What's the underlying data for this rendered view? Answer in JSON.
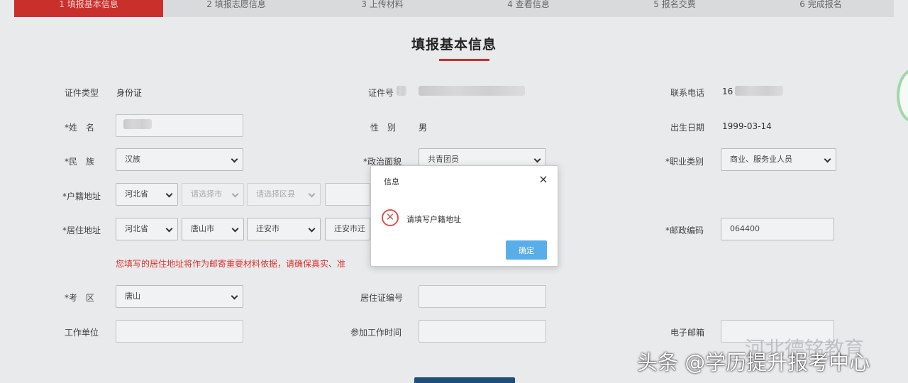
{
  "steps": [
    "1 填报基本信息",
    "2 填报志愿信息",
    "3 上传材料",
    "4 查看信息",
    "5 报名交费",
    "6 完成报名"
  ],
  "page_title": "填报基本信息",
  "form": {
    "id_type_label": "证件类型",
    "id_type_value": "身份证",
    "id_number_label": "证件号",
    "phone_label": "联系电话",
    "phone_value": "16",
    "name_label": "*姓　名",
    "gender_label": "性　别",
    "gender_value": "男",
    "birth_label": "出生日期",
    "birth_value": "1999-03-14",
    "ethnicity_label": "*民　族",
    "ethnicity_value": "汉族",
    "political_label": "*政治面貌",
    "political_value": "共青团员",
    "occupation_label": "*职业类别",
    "occupation_value": "商业、服务业人员",
    "hukou_label": "*户籍地址",
    "hukou_province": "河北省",
    "hukou_city": "请选择市",
    "hukou_district": "请选择区县",
    "residence_label": "*居住地址",
    "residence_province": "河北省",
    "residence_city": "唐山市",
    "residence_district": "迁安市",
    "residence_detail": "迁安市迁",
    "postal_label": "*邮政编码",
    "postal_value": "064400",
    "warning": "您填写的居住地址将作为邮寄重要材料依据，请确保真实、准",
    "exam_area_label": "*考　区",
    "exam_area_value": "唐山",
    "residence_permit_label": "居住证编号",
    "employer_label": "工作单位",
    "work_start_label": "参加工作时间",
    "email_label": "电子邮箱"
  },
  "modal": {
    "title": "信息",
    "close": "×",
    "message": "请填写户籍地址",
    "confirm": "确定"
  },
  "watermark": "头条 @学历提升报考中心",
  "watermark_faint": "河北德铭教育",
  "colors": {
    "accent": "#c9302c",
    "primary_button": "#5aaee8",
    "error": "#e0514c"
  }
}
